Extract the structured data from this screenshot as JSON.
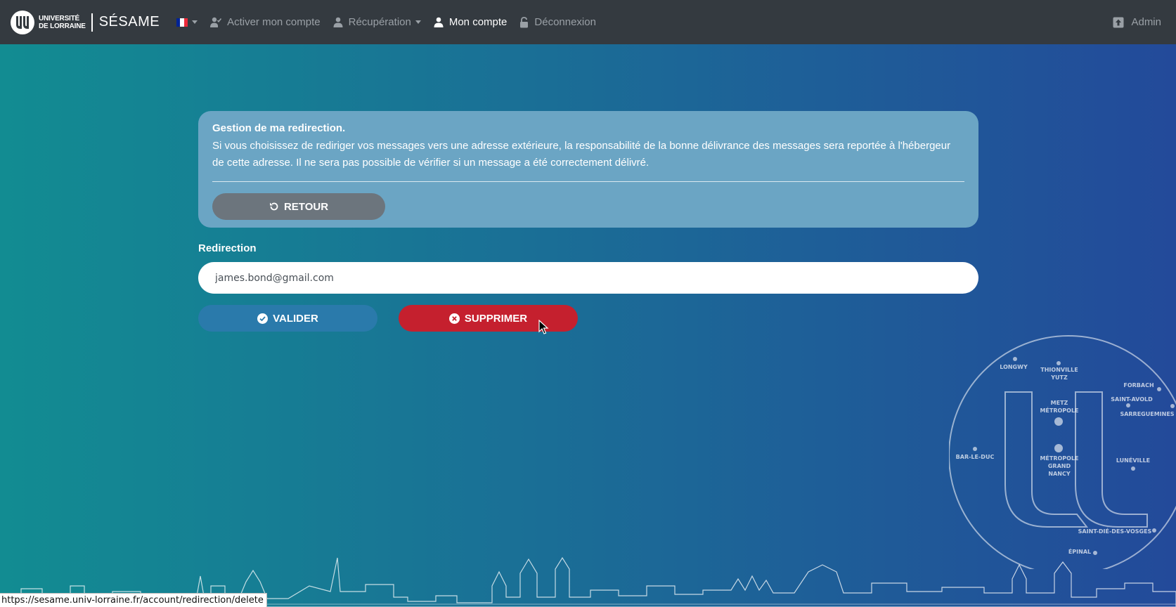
{
  "navbar": {
    "logo_line1": "UNIVERSITÉ",
    "logo_line2": "DE LORRAINE",
    "brand": "SÉSAME",
    "items": [
      {
        "label": "Activer mon compte",
        "icon": "user-check-icon"
      },
      {
        "label": "Récupération",
        "icon": "user-icon"
      },
      {
        "label": "Mon compte",
        "icon": "user-icon"
      },
      {
        "label": "Déconnexion",
        "icon": "unlock-icon"
      }
    ],
    "admin": "Admin"
  },
  "alert": {
    "title": "Gestion de ma redirection.",
    "body": "Si vous choisissez de rediriger vos messages vers une adresse extérieure, la responsabilité de la bonne délivrance des messages sera reportée à l'hébergeur de cette adresse. Il ne sera pas possible de vérifier si un message a été correctement délivré.",
    "back_button": "RETOUR"
  },
  "form": {
    "label": "Redirection",
    "value": "james.bond@gmail.com",
    "validate_button": "VALIDER",
    "delete_button": "SUPPRIMER"
  },
  "map": {
    "cities": [
      "LONGWY",
      "THIONVILLE",
      "YUTZ",
      "FORBACH",
      "SAINT-AVOLD",
      "SARREGUEMINES",
      "METZ",
      "MÉTROPOLE",
      "BAR-LE-DUC",
      "MÉTROPOLE",
      "GRAND",
      "NANCY",
      "LUNÉVILLE",
      "SAINT-DIÉ-DES-VOSGES",
      "ÉPINAL"
    ]
  },
  "status_bar": "https://sesame.univ-lorraine.fr/account/redirection/delete",
  "colors": {
    "navbar": "#343a40",
    "alert": "#6ba5c4",
    "valider": "#2a7aab",
    "supprimer": "#c5202e",
    "retour": "#6c757d"
  }
}
